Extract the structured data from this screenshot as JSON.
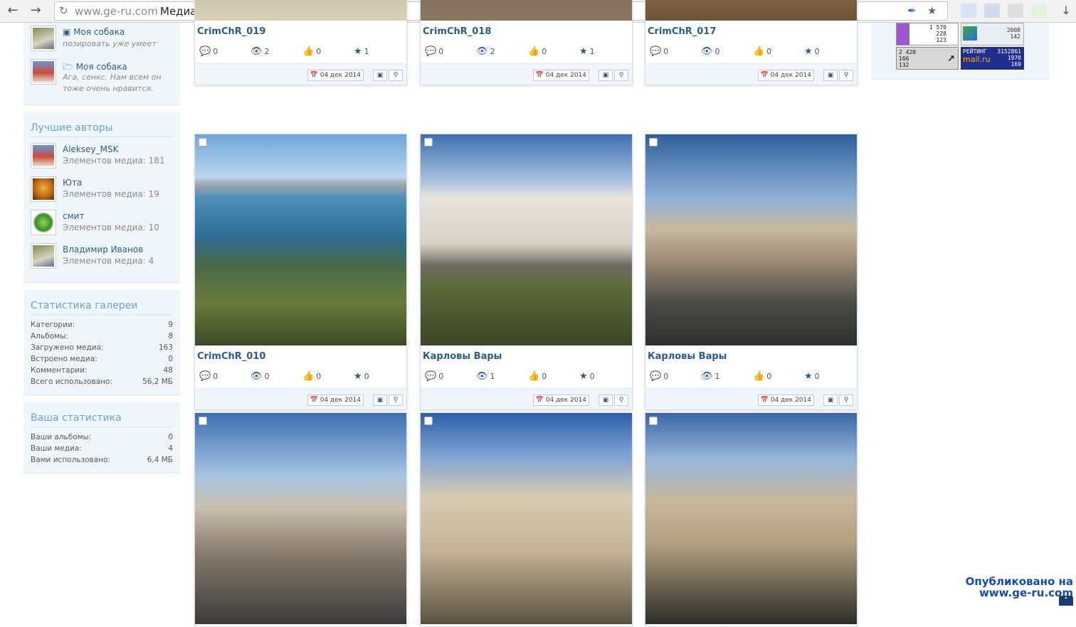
{
  "browser": {
    "url_domain": "www.ge-ru.com",
    "page_title": "Медиа | Форум портала Ge-Ru",
    "icons": [
      "back-icon",
      "forward-icon",
      "reload-icon",
      "pen-icon",
      "star-icon",
      "cloud-icon",
      "mail-icon",
      "puzzle-icon",
      "shield-icon",
      "download-icon"
    ]
  },
  "sidebar": {
    "recent": [
      {
        "title": "Моя собака",
        "subtitle": "позировать уже умеет",
        "icon": "image-icon"
      },
      {
        "title": "Моя собака",
        "subtitle": "Ага, сенкс. Нам всем он тоже очень нравится.",
        "icon": "folder-icon"
      }
    ],
    "best_authors": {
      "heading": "Лучшие авторы",
      "items": [
        {
          "name": "Aleksey_MSK",
          "count": "Элементов медиа: 181"
        },
        {
          "name": "Юта",
          "count": "Элементов медиа: 19"
        },
        {
          "name": "смит",
          "count": "Элементов медиа: 10"
        },
        {
          "name": "Владимир Иванов",
          "count": "Элементов медиа: 4"
        }
      ]
    },
    "gallery_stats": {
      "heading": "Статистика галереи",
      "rows": [
        {
          "label": "Категории:",
          "value": "9"
        },
        {
          "label": "Альбомы:",
          "value": "8"
        },
        {
          "label": "Загружено медиа:",
          "value": "163"
        },
        {
          "label": "Встроено медиа:",
          "value": "0"
        },
        {
          "label": "Комментарии:",
          "value": "48"
        },
        {
          "label": "Всего использовано:",
          "value": "56,2 МБ"
        }
      ]
    },
    "your_stats": {
      "heading": "Ваша статистика",
      "rows": [
        {
          "label": "Ваши альбомы:",
          "value": "0"
        },
        {
          "label": "Ваши медиа:",
          "value": "4"
        },
        {
          "label": "Вами использовано:",
          "value": "6,4 МБ"
        }
      ]
    }
  },
  "gallery": {
    "cards": [
      {
        "title": "CrimChR_019",
        "comments": "0",
        "views": "2",
        "likes": "0",
        "rating": "1",
        "date": "04 дек 2014"
      },
      {
        "title": "CrimChR_018",
        "comments": "0",
        "views": "2",
        "likes": "0",
        "rating": "1",
        "date": "04 дек 2014"
      },
      {
        "title": "CrimChR_017",
        "comments": "0",
        "views": "0",
        "likes": "0",
        "rating": "0",
        "date": "04 дек 2014"
      },
      {
        "title": "CrimChR_010",
        "comments": "0",
        "views": "0",
        "likes": "0",
        "rating": "0",
        "date": "04 дек 2014"
      },
      {
        "title": "Карловы Вары",
        "comments": "0",
        "views": "1",
        "likes": "0",
        "rating": "0",
        "date": "04 дек 2014"
      },
      {
        "title": "Карловы Вары",
        "comments": "0",
        "views": "1",
        "likes": "0",
        "rating": "0",
        "date": "04 дек 2014"
      },
      {
        "title": "",
        "comments": "",
        "views": "",
        "likes": "",
        "rating": "",
        "date": ""
      },
      {
        "title": "",
        "comments": "",
        "views": "",
        "likes": "",
        "rating": "",
        "date": ""
      },
      {
        "title": "",
        "comments": "",
        "views": "",
        "likes": "",
        "rating": "",
        "date": ""
      }
    ]
  },
  "counters": {
    "liveinternet": [
      "1 570",
      "228",
      "123"
    ],
    "top": [
      "2008",
      "142"
    ],
    "mini": [
      "2 420",
      "166",
      "132"
    ],
    "mailru_label": "РЕЙТИНГ",
    "mailru_brand": "mail.ru",
    "mailru_nums": [
      "3152861",
      "1970",
      "169"
    ]
  },
  "watermark": {
    "line1": "Опубликовано на",
    "line2": "www.ge-ru.com"
  }
}
